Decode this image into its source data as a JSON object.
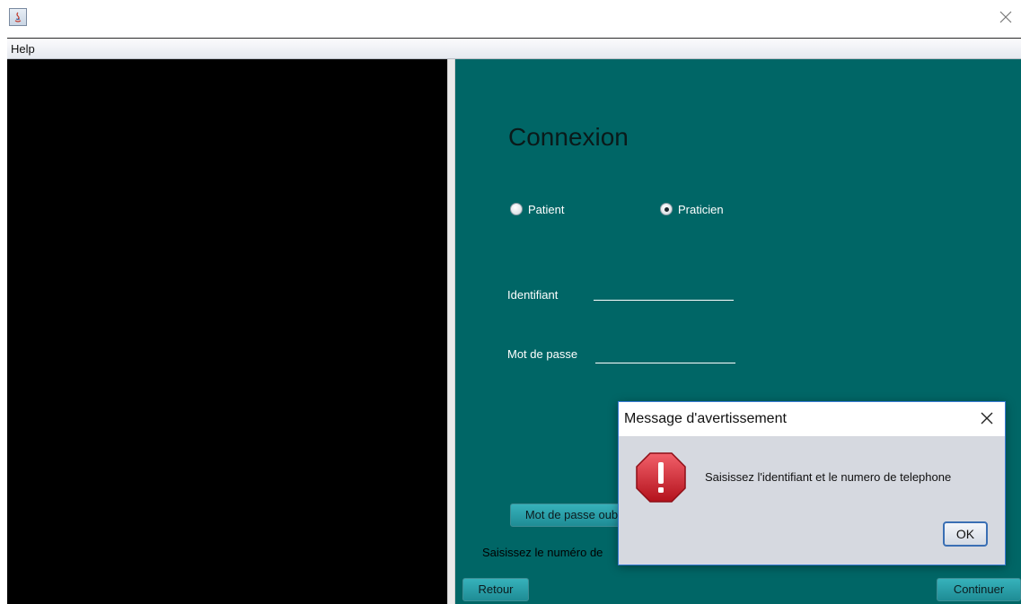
{
  "menu": {
    "help": "Help"
  },
  "login": {
    "title": "Connexion",
    "radio_patient": "Patient",
    "radio_praticien": "Praticien",
    "selected": "Praticien",
    "identifiant_label": "Identifiant",
    "identifiant_value": "",
    "password_label": "Mot de passe",
    "password_value": "",
    "forgot_button": "Mot de passe oublié",
    "hint_text": "Saisissez le numéro de",
    "back_button": "Retour",
    "continue_button": "Continuer"
  },
  "dialog": {
    "title": "Message d'avertissement",
    "message": "Saisissez l'identifiant et le numero de telephone",
    "ok_button": "OK"
  },
  "colors": {
    "panel_teal": "#006666",
    "button_teal": "#2aa0a8",
    "warning_red": "#c8202a"
  }
}
